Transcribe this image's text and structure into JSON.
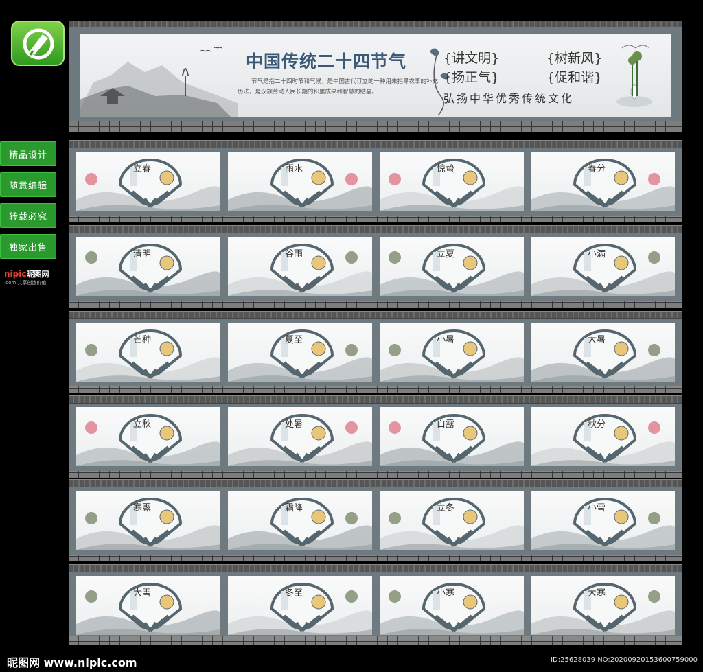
{
  "side_buttons": [
    "精品设计",
    "随意编辑",
    "转载必究",
    "独家出售"
  ],
  "side_brand": {
    "red": "nipic",
    "white": "昵图网",
    "com": ".com",
    "tagline": "共享创造价值"
  },
  "banner": {
    "title": "中国传统二十四节气",
    "description": "节气是指二十四时节和气候，是中国古代订立的一种用来指导农事的补充历法，是汉族劳动人民长期的积累成果和智慧的结晶。",
    "slogans": [
      "{讲文明}",
      "{树新风}",
      "{扬正气}",
      "{促和谐}"
    ],
    "subtitle": "弘扬中华优秀传统文化"
  },
  "rows": [
    [
      "立春",
      "雨水",
      "惊蛰",
      "春分"
    ],
    [
      "清明",
      "谷雨",
      "立夏",
      "小满"
    ],
    [
      "芒种",
      "夏至",
      "小暑",
      "大暑"
    ],
    [
      "立秋",
      "处暑",
      "白露",
      "秋分"
    ],
    [
      "寒露",
      "霜降",
      "立冬",
      "小雪"
    ],
    [
      "大雪",
      "冬至",
      "小寒",
      "大寒"
    ]
  ],
  "footer": {
    "left": "昵图网 www.nipic.com",
    "right": "ID:25628039 NO:20200920153600759000"
  },
  "colors": {
    "frame": "#6f7a80",
    "button": "#2a9a2e",
    "title": "#3b5a78",
    "fan": "#55666e"
  }
}
